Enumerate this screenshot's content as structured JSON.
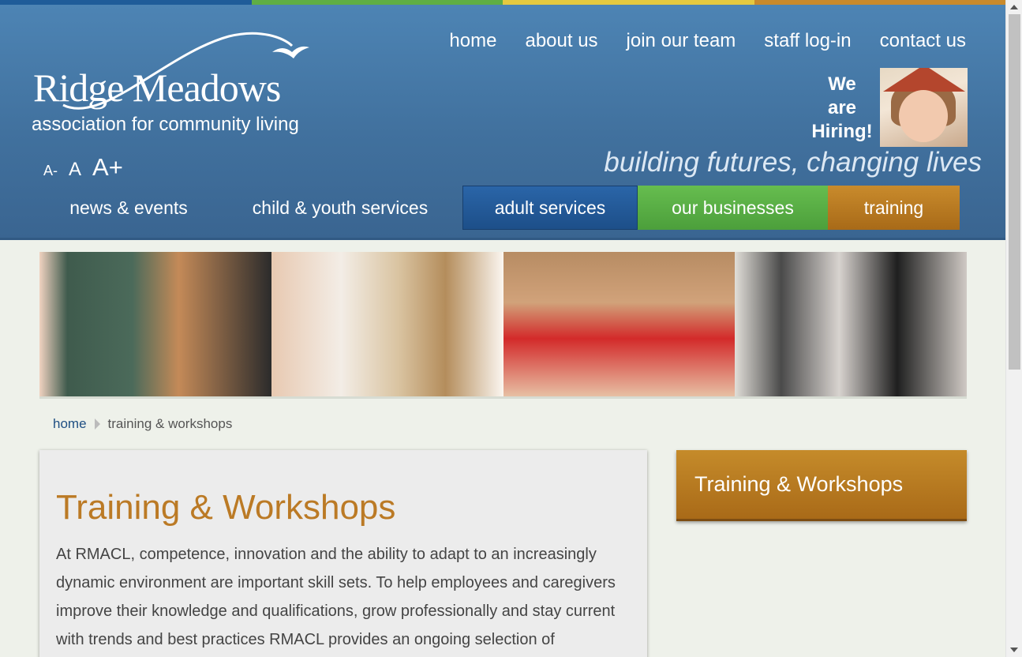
{
  "colors": {
    "header_blue": "#41719e",
    "adult_services": "#235c9c",
    "our_businesses": "#58b146",
    "training": "#b87a22",
    "heading_orange": "#bb7a25",
    "strip": [
      "#1f5c99",
      "#5fae44",
      "#e4c940",
      "#c98a2c"
    ]
  },
  "logo": {
    "name": "Ridge Meadows",
    "subtitle": "association for community living"
  },
  "top_nav": [
    "home",
    "about us",
    "join our team",
    "staff log-in",
    "contact us"
  ],
  "hiring": {
    "line1": "We",
    "line2": "are",
    "line3": "Hiring!"
  },
  "font_size_controls": {
    "decrease": "A-",
    "normal": "A",
    "increase": "A+"
  },
  "tagline": "building futures, changing lives",
  "main_nav": [
    {
      "label": "news & events",
      "color": ""
    },
    {
      "label": "child & youth services",
      "color": ""
    },
    {
      "label": "adult services",
      "color": "#235c9c"
    },
    {
      "label": "our businesses",
      "color": "#58b146"
    },
    {
      "label": "training",
      "color": "#b87a22"
    }
  ],
  "banner_images": [
    "classroom-teacher-photo",
    "seniors-workshop-photo",
    "cpr-training-photo",
    "seminar-audience-photo"
  ],
  "breadcrumb": {
    "home": "home",
    "current": "training & workshops"
  },
  "main": {
    "title": "Training & Workshops",
    "body": "At RMACL, competence, innovation and the ability to adapt to an increasingly dynamic environment are important skill sets. To help employees and caregivers improve their knowledge and qualifications, grow professionally and stay current with trends and best practices RMACL provides an ongoing selection of"
  },
  "sidebar": {
    "title": "Training & Workshops"
  }
}
